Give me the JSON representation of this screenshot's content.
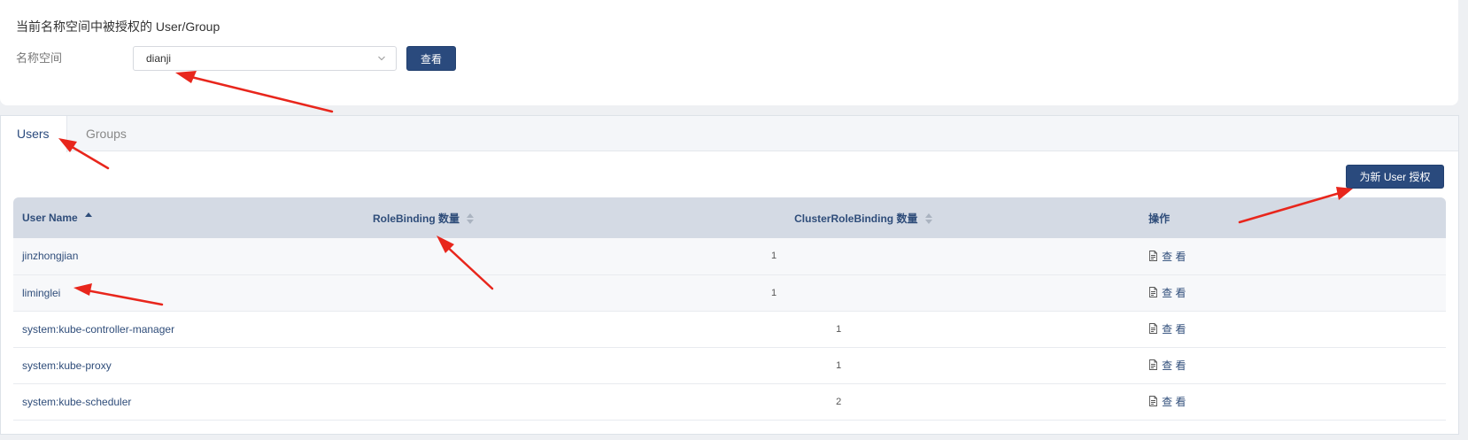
{
  "header": {
    "title": "当前名称空间中被授权的 User/Group",
    "namespace_label": "名称空间",
    "namespace_value": "dianji",
    "view_button": "查看"
  },
  "tabs": [
    {
      "label": "Users",
      "active": true
    },
    {
      "label": "Groups",
      "active": false
    }
  ],
  "grant_button": "为新 User 授权",
  "table": {
    "columns": [
      "User Name",
      "RoleBinding 数量",
      "ClusterRoleBinding 数量",
      "操作"
    ],
    "sort": {
      "column": "User Name",
      "direction": "ascending"
    },
    "action_label": "查 看",
    "rows": [
      {
        "name": "jinzhongjian",
        "rolebinding": "1",
        "clusterrolebinding": ""
      },
      {
        "name": "liminglei",
        "rolebinding": "1",
        "clusterrolebinding": ""
      },
      {
        "name": "system:kube-controller-manager",
        "rolebinding": "",
        "clusterrolebinding": "1"
      },
      {
        "name": "system:kube-proxy",
        "rolebinding": "",
        "clusterrolebinding": "1"
      },
      {
        "name": "system:kube-scheduler",
        "rolebinding": "",
        "clusterrolebinding": "2"
      }
    ]
  },
  "colors": {
    "primary": "#2a4a7d",
    "table_header_bg": "#d4dae4",
    "annotation_arrow": "#e8261c"
  },
  "icons": {
    "select_chevron": "chevron-down-icon",
    "sort_active": "sort-ascending-icon",
    "sort_inactive": "sort-icon",
    "action": "document-icon"
  }
}
